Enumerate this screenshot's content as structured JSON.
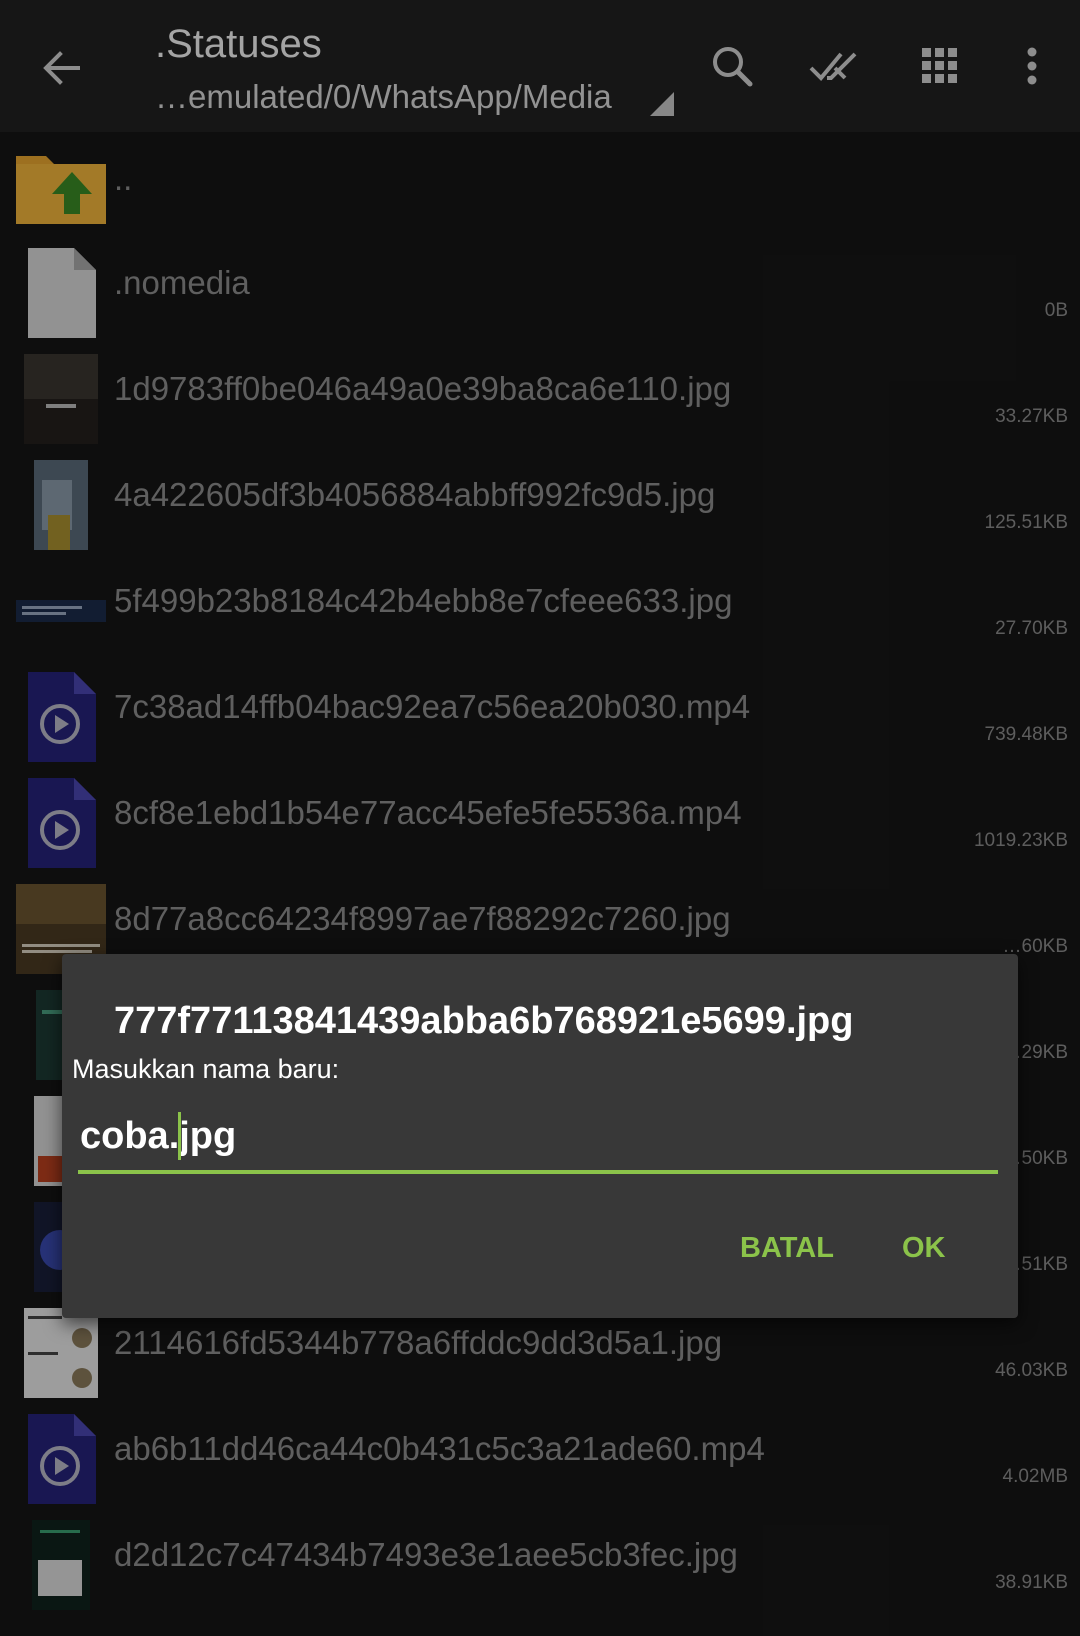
{
  "toolbar": {
    "title": ".Statuses",
    "path": "…emulated/0/WhatsApp/Media",
    "icons": [
      "back-arrow-icon",
      "search-icon",
      "select-all-icon",
      "grid-view-icon",
      "more-vert-icon"
    ]
  },
  "files": [
    {
      "name": "..",
      "size": "",
      "icon": "folder-up-icon"
    },
    {
      "name": ".nomedia",
      "size": "0B",
      "icon": "generic-file-icon"
    },
    {
      "name": "1d9783ff0be046a49a0e39ba8ca6e110.jpg",
      "size": "33.27KB",
      "icon": "image-thumbnail"
    },
    {
      "name": "4a422605df3b4056884abbff992fc9d5.jpg",
      "size": "125.51KB",
      "icon": "image-thumbnail"
    },
    {
      "name": "5f499b23b8184c42b4ebb8e7cfeee633.jpg",
      "size": "27.70KB",
      "icon": "image-thumbnail"
    },
    {
      "name": "7c38ad14ffb04bac92ea7c56ea20b030.mp4",
      "size": "739.48KB",
      "icon": "video-file-icon"
    },
    {
      "name": "8cf8e1ebd1b54e77acc45efe5fe5536a.mp4",
      "size": "1019.23KB",
      "icon": "video-file-icon"
    },
    {
      "name": "8d77a8cc64234f8997ae7f88292c7260.jpg",
      "size": "…60KB",
      "icon": "image-thumbnail"
    },
    {
      "name": "",
      "size": "…29KB",
      "icon": "image-thumbnail"
    },
    {
      "name": "",
      "size": "…50KB",
      "icon": "image-thumbnail"
    },
    {
      "name": "",
      "size": "…51KB",
      "icon": "image-thumbnail"
    },
    {
      "name": "2114616fd5344b778a6ffddc9dd3d5a1.jpg",
      "size": "46.03KB",
      "icon": "image-thumbnail"
    },
    {
      "name": "ab6b11dd46ca44c0b431c5c3a21ade60.mp4",
      "size": "4.02MB",
      "icon": "video-file-icon"
    },
    {
      "name": "d2d12c7c47434b7493e3e1aee5cb3fec.jpg",
      "size": "38.91KB",
      "icon": "image-thumbnail"
    }
  ],
  "dialog": {
    "title": "777f77113841439abba6b768921e5699.jpg",
    "prompt": "Masukkan nama baru:",
    "input_value": "coba.jpg",
    "cancel_label": "BATAL",
    "ok_label": "OK"
  },
  "colors": {
    "accent": "#8bc34a",
    "folder": "#e8a530",
    "video_file": "#26237a"
  }
}
